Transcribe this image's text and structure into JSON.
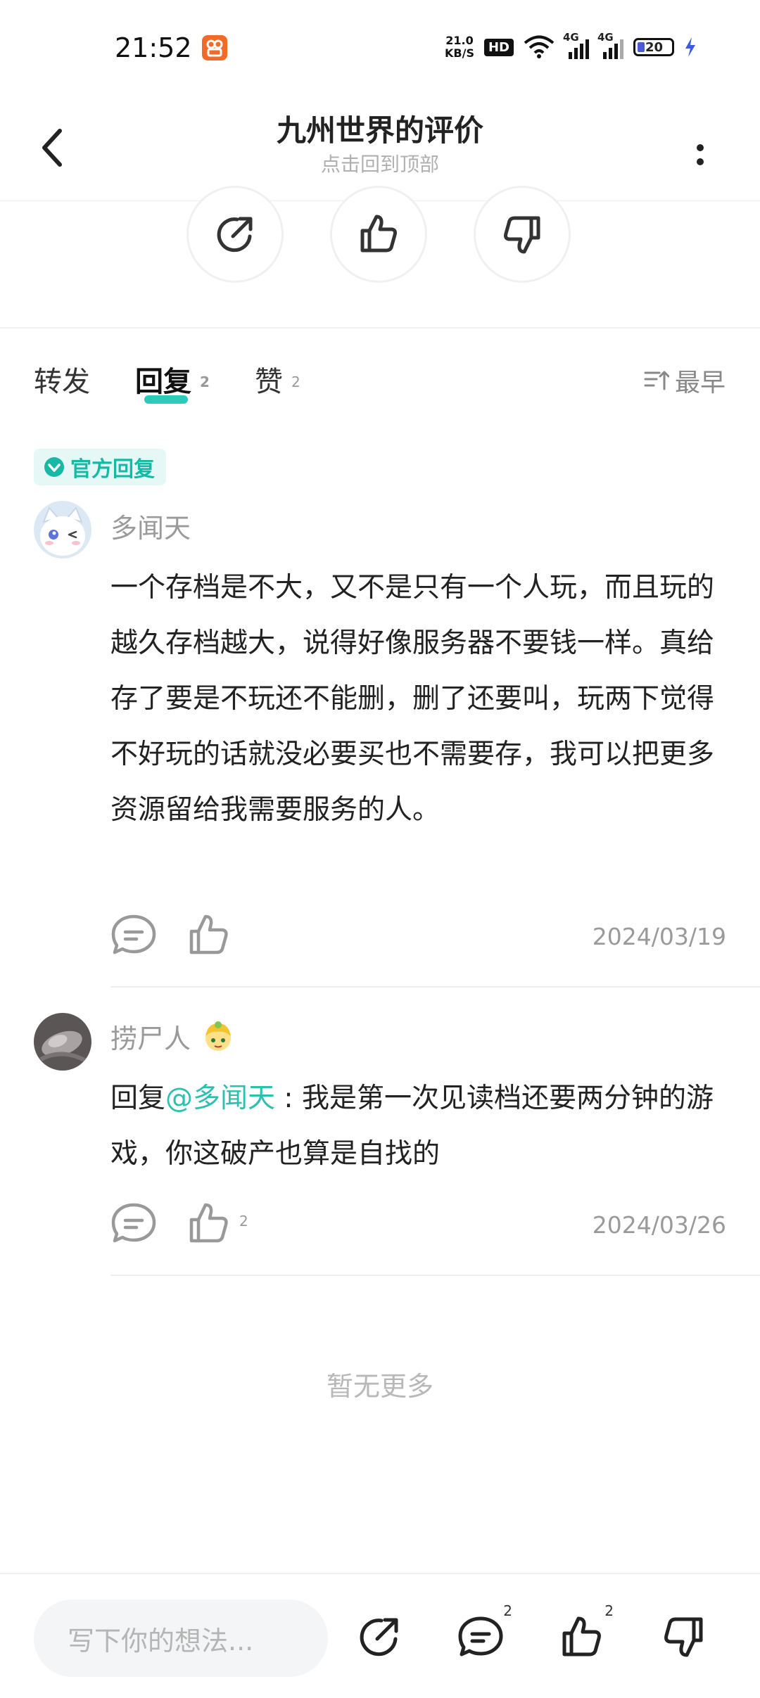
{
  "status_bar": {
    "time": "21:52",
    "net_speed_value": "21.0",
    "net_speed_unit": "KB/S",
    "hd_label": "HD",
    "sig1_label": "4G",
    "sig2_label": "4G",
    "battery_level": "20"
  },
  "nav": {
    "title": "九州世界的评价",
    "subtitle": "点击回到顶部"
  },
  "tabs": {
    "forward_label": "转发",
    "reply_label": "回复",
    "reply_count": "2",
    "like_label": "赞",
    "like_count": "2",
    "sort_label": "最早"
  },
  "official_badge": "官方回复",
  "replies": [
    {
      "username": "多闻天",
      "content": "一个存档是不大，又不是只有一个人玩，而且玩的越久存档越大，说得好像服务器不要钱一样。真给存了要是不玩还不能删，删了还要叫，玩两下觉得不好玩的话就没必要买也不需要存，我可以把更多资源留给我需要服务的人。",
      "date": "2024/03/19",
      "like_count": ""
    },
    {
      "username": "捞尸人",
      "reply_prefix": "回复",
      "mention": "@多闻天",
      "content": " : 我是第一次见读档还要两分钟的游戏，你这破产也算是自找的",
      "date": "2024/03/26",
      "like_count": "2"
    }
  ],
  "no_more": "暂无更多",
  "bottom_bar": {
    "input_placeholder": "写下你的想法...",
    "comment_count": "2",
    "like_count": "2"
  },
  "colors": {
    "accent": "#2dcabb",
    "mention": "#2dc0b0",
    "app_badge": "#f26a2a"
  }
}
